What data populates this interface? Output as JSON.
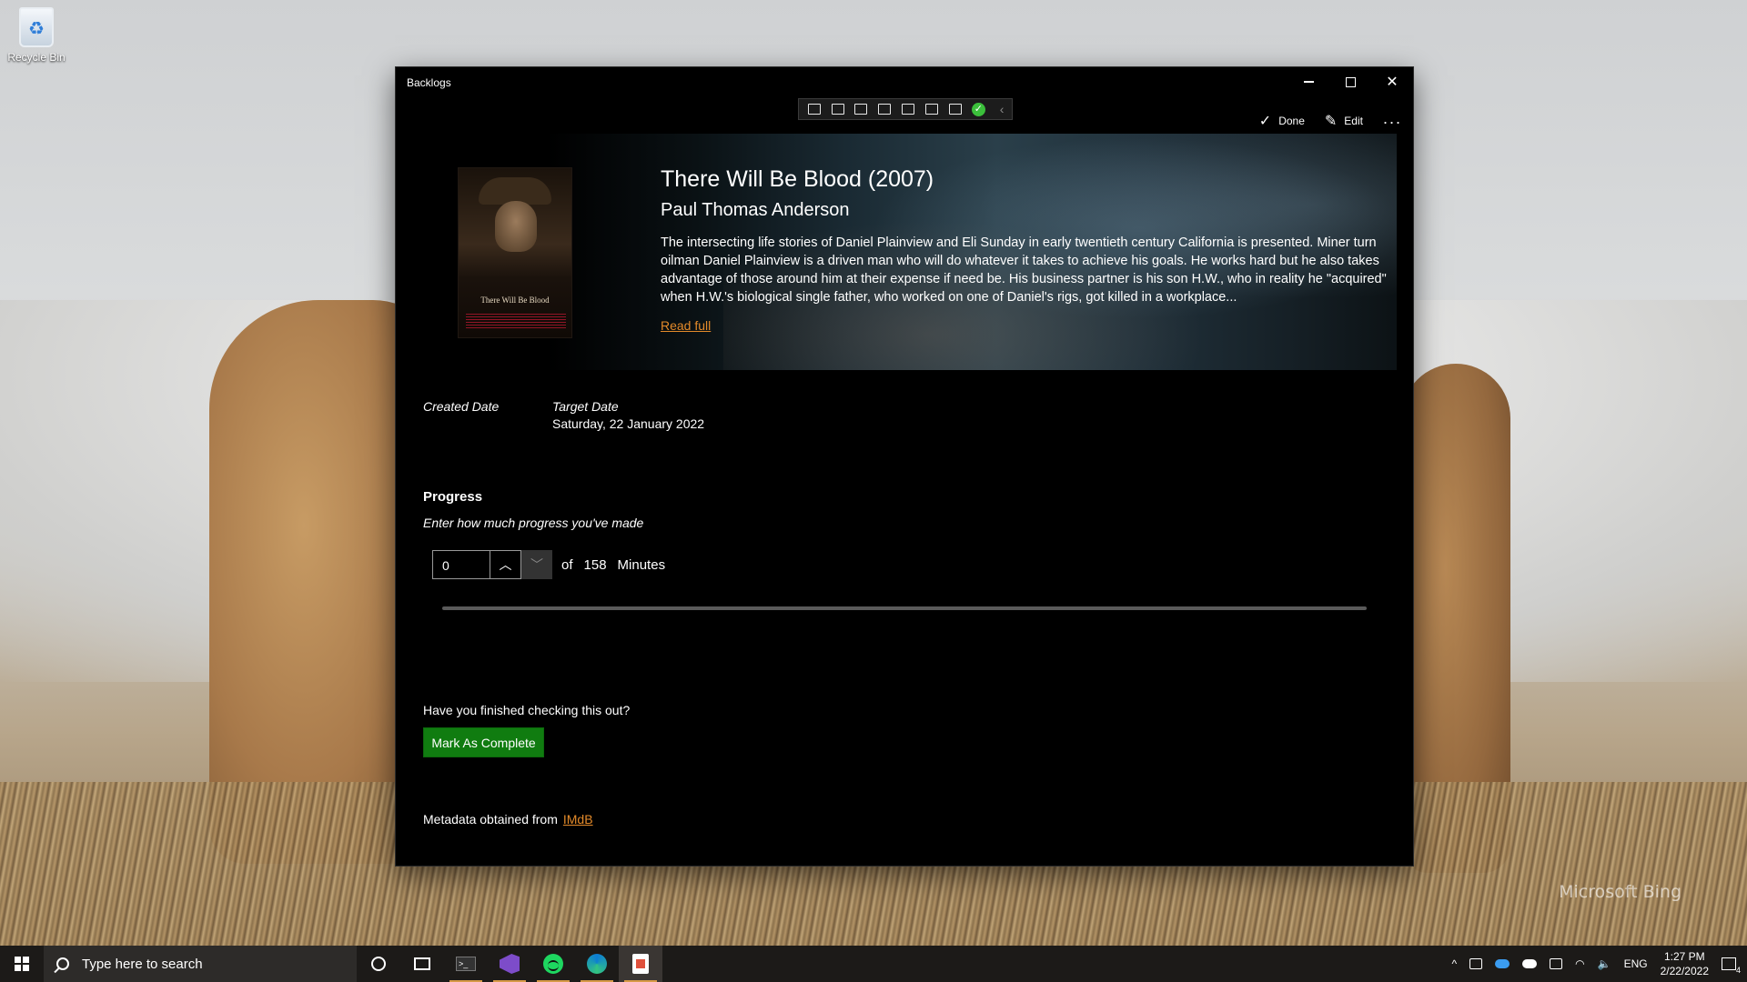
{
  "desktop": {
    "recycle_bin_label": "Recycle Bin",
    "wallpaper_watermark": "Microsoft Bing"
  },
  "window": {
    "title": "Backlogs",
    "minimize_glyph": "–",
    "commands": {
      "done_label": "Done",
      "edit_label": "Edit"
    }
  },
  "debug_toolbar": {
    "icons": [
      "live-visual-tree-icon",
      "record-icon",
      "select-element-icon",
      "display-layout-adorners-icon",
      "track-focus-icon",
      "binding-failures-icon",
      "hot-reload-icon",
      "hot-reload-ok-icon",
      "collapse-icon"
    ],
    "collapse_glyph": "‹"
  },
  "hero": {
    "title": "There Will Be Blood (2007)",
    "director": "Paul Thomas Anderson",
    "description": "The intersecting life stories of Daniel Plainview and Eli Sunday in early twentieth century California is presented. Miner turn oilman Daniel Plainview is a driven man who will do whatever it takes to achieve his goals. He works hard but he also takes advantage of those around him at their expense if need be. His business partner is his son H.W., who in reality he \"acquired\" when H.W.'s biological single father, who worked on one of Daniel's rigs, got killed in a workplace...",
    "read_full_label": "Read full",
    "poster_title": "There Will Be Blood"
  },
  "dates": {
    "created_label": "Created Date",
    "target_label": "Target Date",
    "target_value": "Saturday, 22 January 2022"
  },
  "progress": {
    "heading": "Progress",
    "hint": "Enter how much progress you've made",
    "current_value": "0",
    "of_label": "of",
    "total": "158",
    "unit": "Minutes",
    "fraction": 0
  },
  "completion": {
    "question": "Have you finished checking this out?",
    "button_label": "Mark As Complete"
  },
  "metadata": {
    "prefix": "Metadata obtained from",
    "source_link": "IMdB"
  },
  "taskbar": {
    "search_placeholder": "Type here to search",
    "terminal_label": ">_",
    "language": "ENG",
    "time": "1:27 PM",
    "date": "2/22/2022",
    "notification_count": "4"
  },
  "colors": {
    "accent_link": "#e38a2a",
    "complete_button": "#107c10",
    "window_bg": "#000000"
  }
}
